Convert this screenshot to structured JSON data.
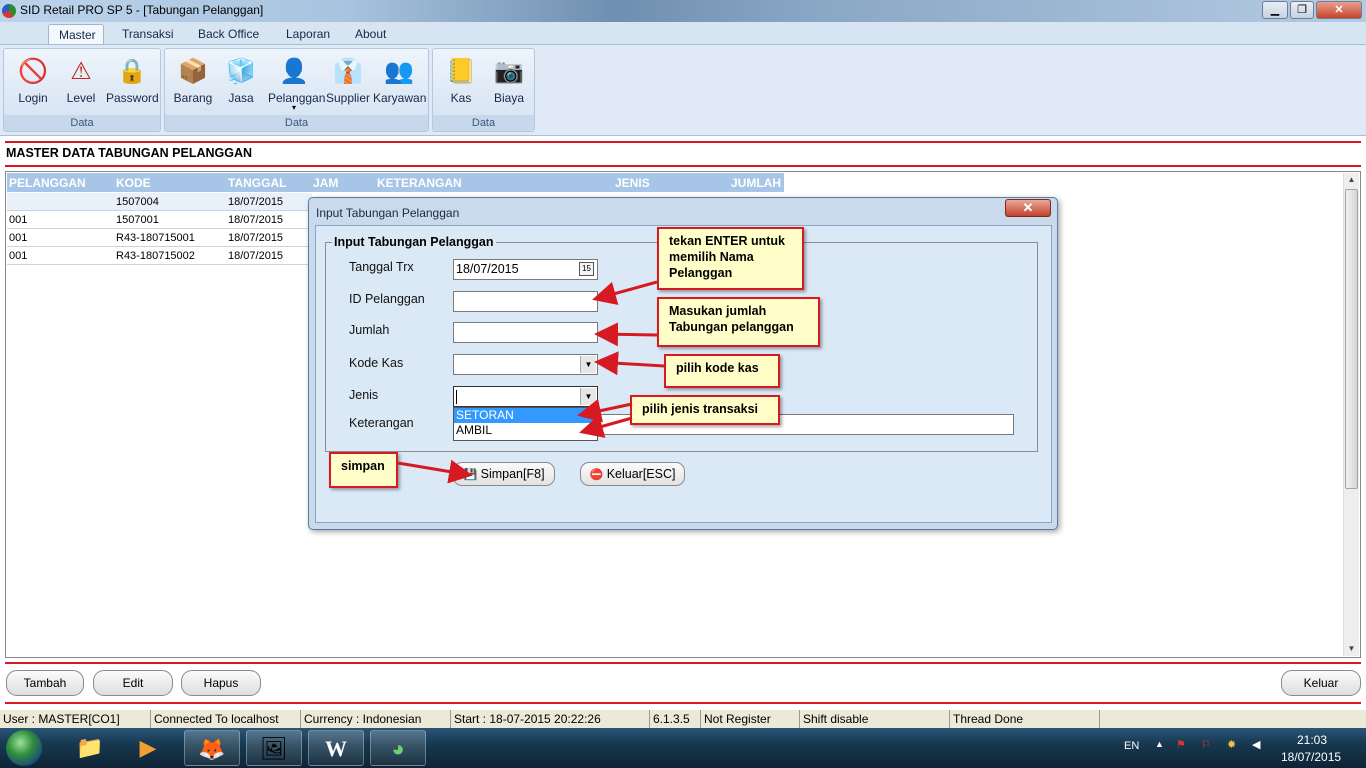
{
  "window": {
    "title": "SID Retail PRO SP 5 - [Tabungan Pelanggan]",
    "controls": {
      "minimize": "▁",
      "restore": "❐",
      "close": "✕"
    }
  },
  "menu": {
    "tabs": [
      {
        "label": "Master",
        "active": true
      },
      {
        "label": "Transaksi"
      },
      {
        "label": "Back Office"
      },
      {
        "label": "Laporan"
      },
      {
        "label": "About"
      }
    ]
  },
  "ribbon": {
    "groups": [
      {
        "label": "Data",
        "buttons": [
          {
            "label": "Login",
            "icon": "no-entry-icon",
            "glyph": "🚫"
          },
          {
            "label": "Level",
            "icon": "warning-icon",
            "glyph": "⚠"
          },
          {
            "label": "Password",
            "icon": "lock-icon",
            "glyph": "🔒"
          }
        ]
      },
      {
        "label": "Data",
        "buttons": [
          {
            "label": "Barang",
            "icon": "cubes-icon",
            "glyph": "📦"
          },
          {
            "label": "Jasa",
            "icon": "cubes-icon",
            "glyph": "🧊"
          },
          {
            "label": "Pelanggan",
            "icon": "customer-icon",
            "glyph": "👤",
            "dropdown": "▾"
          },
          {
            "label": "Supplier",
            "icon": "supplier-icon",
            "glyph": "👔"
          },
          {
            "label": "Karyawan",
            "icon": "employees-icon",
            "glyph": "👥"
          }
        ]
      },
      {
        "label": "Data",
        "buttons": [
          {
            "label": "Kas",
            "icon": "cash-book-icon",
            "glyph": "📒"
          },
          {
            "label": "Biaya",
            "icon": "webcam-icon",
            "glyph": "📷"
          }
        ]
      }
    ]
  },
  "page": {
    "title": "MASTER DATA TABUNGAN PELANGGAN"
  },
  "grid": {
    "columns": [
      "PELANGGAN",
      "KODE",
      "TANGGAL",
      "JAM",
      "KETERANGAN",
      "JENIS",
      "JUMLAH"
    ],
    "rows": [
      {
        "pelanggan": "",
        "kode": "1507004",
        "tanggal": "18/07/2015"
      },
      {
        "pelanggan": "001",
        "kode": "1507001",
        "tanggal": "18/07/2015"
      },
      {
        "pelanggan": "001",
        "kode": "R43-180715001",
        "tanggal": "18/07/2015"
      },
      {
        "pelanggan": "001",
        "kode": "R43-180715002",
        "tanggal": "18/07/2015"
      }
    ]
  },
  "dialog": {
    "title": "Input Tabungan Pelanggan",
    "close_glyph": "✕",
    "group_title": "Input Tabungan Pelanggan",
    "fields": {
      "tanggal": {
        "label": "Tanggal Trx",
        "value": "18/07/2015",
        "calendar_glyph": "15"
      },
      "id_pelanggan": {
        "label": "ID Pelanggan",
        "value": ""
      },
      "jumlah": {
        "label": "Jumlah",
        "value": ""
      },
      "kode_kas": {
        "label": "Kode Kas",
        "value": ""
      },
      "jenis": {
        "label": "Jenis",
        "value": "",
        "options": [
          "SETORAN",
          "AMBIL"
        ],
        "highlighted": "SETORAN"
      },
      "keterangan": {
        "label": "Keterangan",
        "value": ""
      }
    },
    "dropdown_glyph": "▼",
    "buttons": {
      "simpan": {
        "label": "Simpan[F8]",
        "icon": "save-icon",
        "glyph": "💾"
      },
      "keluar": {
        "label": "Keluar[ESC]",
        "icon": "exit-icon",
        "glyph": "⛔"
      }
    }
  },
  "annotations": {
    "enter": "tekan ENTER untuk memilih Nama Pelanggan",
    "jumlah": "Masukan jumlah Tabungan pelanggan",
    "kodekas": "pilih kode kas",
    "jenis": "pilih jenis transaksi",
    "simpan": "simpan",
    "arrow_color": "#d71a21"
  },
  "bottom_buttons": {
    "tambah": "Tambah",
    "edit": "Edit",
    "hapus": "Hapus",
    "keluar": "Keluar"
  },
  "status": {
    "user": "User : MASTER[CO1]",
    "connection": "Connected To localhost",
    "currency": "Currency : Indonesian",
    "start": "Start  : 18-07-2015 20:22:26",
    "version": "6.1.3.5",
    "register": "Not Register",
    "shift": "Shift disable",
    "thread": "Thread Done"
  },
  "taskbar": {
    "items": [
      {
        "name": "explorer",
        "glyph": "📁"
      },
      {
        "name": "media-player",
        "glyph": "▶"
      },
      {
        "name": "firefox",
        "glyph": "🦊"
      },
      {
        "name": "image-viewer",
        "glyph": "🖼"
      },
      {
        "name": "word",
        "glyph": "W"
      },
      {
        "name": "sid-retail",
        "glyph": "◕"
      }
    ],
    "lang": "EN",
    "time": "21:03",
    "date": "18/07/2015"
  },
  "colors": {
    "accent_red": "#d71a21",
    "grid_header": "#a7c5e6",
    "selection": "#3399ff"
  }
}
